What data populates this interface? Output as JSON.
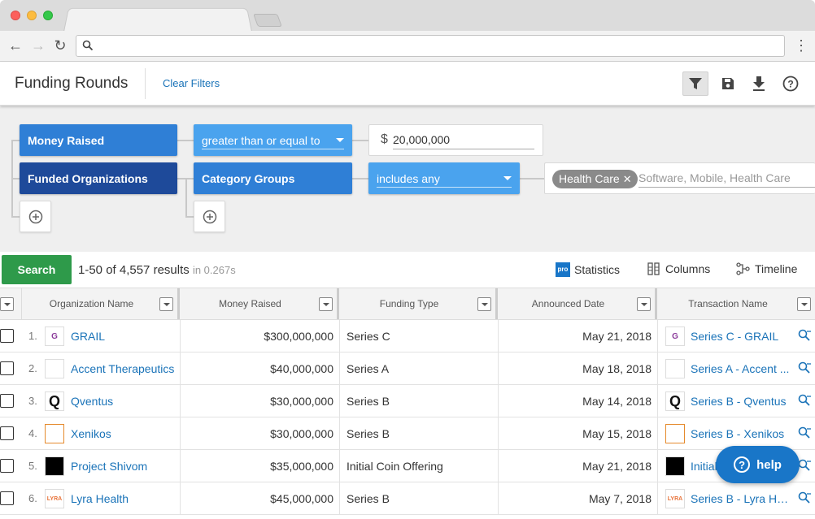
{
  "browser": {
    "url": "",
    "icons": [
      "back-arrow-icon",
      "forward-arrow-icon",
      "reload-icon",
      "search-icon",
      "menu-dots-icon"
    ]
  },
  "header": {
    "title": "Funding Rounds",
    "clear_filters": "Clear Filters",
    "icons": [
      "filter-icon",
      "save-icon",
      "download-icon",
      "help-icon"
    ]
  },
  "filters": {
    "row1": {
      "field": "Money Raised",
      "operator": "greater than or equal to",
      "currency": "$",
      "value": "20,000,000"
    },
    "row2": {
      "field": "Funded Organizations",
      "sub_field": "Category Groups",
      "operator": "includes any",
      "tag": "Health Care",
      "placeholder": "Software, Mobile, Health Care"
    }
  },
  "results": {
    "search_label": "Search",
    "count_text": "1-50 of 4,557 results",
    "time_text": "in 0.267s",
    "pro_badge": "pro",
    "statistics": "Statistics",
    "columns": "Columns",
    "timeline": "Timeline"
  },
  "table": {
    "headers": {
      "org": "Organization Name",
      "money": "Money Raised",
      "type": "Funding Type",
      "date": "Announced Date",
      "txn": "Transaction Name"
    },
    "rows": [
      {
        "num": "1.",
        "logo": "G",
        "logo_color": "#8a3a9a",
        "org": "GRAIL",
        "money": "$300,000,000",
        "type": "Series C",
        "date": "May 21, 2018",
        "txn": "Series C - GRAIL"
      },
      {
        "num": "2.",
        "logo": "",
        "logo_color": "#cccccc",
        "org": "Accent Therapeutics",
        "money": "$40,000,000",
        "type": "Series A",
        "date": "May 18, 2018",
        "txn": "Series A - Accent ..."
      },
      {
        "num": "3.",
        "logo": "Q",
        "logo_color": "#111111",
        "org": "Qventus",
        "money": "$30,000,000",
        "type": "Series B",
        "date": "May 14, 2018",
        "txn": "Series B - Qventus"
      },
      {
        "num": "4.",
        "logo": "",
        "logo_color": "#e58a2c",
        "org": "Xenikos",
        "money": "$30,000,000",
        "type": "Series B",
        "date": "May 15, 2018",
        "txn": "Series B - Xenikos"
      },
      {
        "num": "5.",
        "logo": "",
        "logo_color": "#000000",
        "org": "Project Shivom",
        "money": "$35,000,000",
        "type": "Initial Coin Offering",
        "date": "May 21, 2018",
        "txn": "Initial"
      },
      {
        "num": "6.",
        "logo": "LYRA",
        "logo_color": "#e8733a",
        "org": "Lyra Health",
        "money": "$45,000,000",
        "type": "Series B",
        "date": "May 7, 2018",
        "txn": "Series B - Lyra He..."
      }
    ]
  },
  "help": {
    "label": "help",
    "q": "?"
  },
  "colors": {
    "accent": "#1a73b8",
    "search_green": "#2e9a4a",
    "chip_blue": "#2f7fd6",
    "chip_dark": "#1e4a9a",
    "chip_light": "#4aa3ee",
    "help_blue": "#1976c8"
  }
}
